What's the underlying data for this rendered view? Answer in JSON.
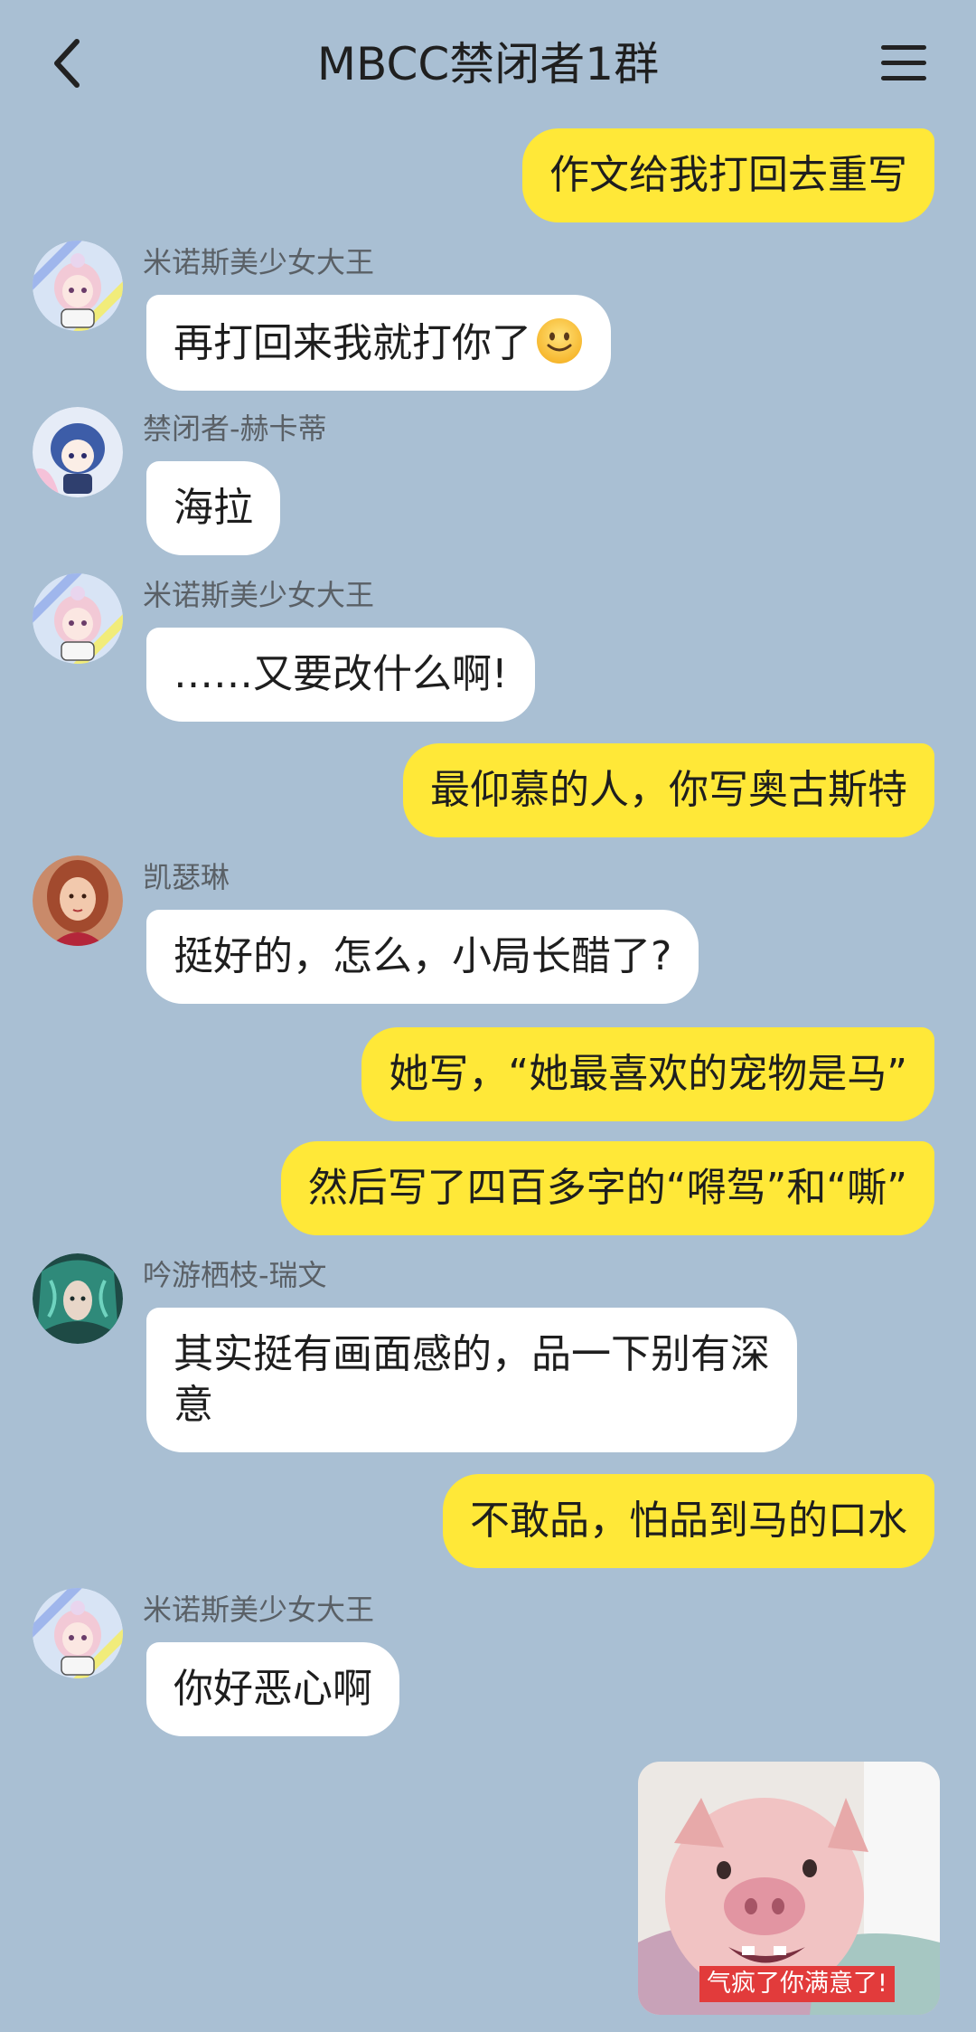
{
  "header": {
    "title": "MBCC禁闭者1群",
    "back_icon": "chevron-left-icon",
    "menu_icon": "hamburger-menu-icon"
  },
  "messages": [
    {
      "side": "out",
      "text": "作文给我打回去重写"
    },
    {
      "side": "in",
      "sender": "米诺斯美少女大王",
      "text": "再打回来我就打你了",
      "emoji": "slight-smile-emoji"
    },
    {
      "side": "in",
      "sender": "禁闭者-赫卡蒂",
      "text": "海拉"
    },
    {
      "side": "in",
      "sender": "米诺斯美少女大王",
      "text": "……又要改什么啊!"
    },
    {
      "side": "out",
      "text": "最仰慕的人，你写奥古斯特"
    },
    {
      "side": "in",
      "sender": "凯瑟琳",
      "text": "挺好的，怎么，小局长醋了?"
    },
    {
      "side": "out",
      "text": "她写，“她最喜欢的宠物是马”"
    },
    {
      "side": "out",
      "text": "然后写了四百多字的“嘚驾”和“嘶”"
    },
    {
      "side": "in",
      "sender": "吟游栖枝-瑞文",
      "text": "其实挺有画面感的，品一下别有深意"
    },
    {
      "side": "out",
      "text": "不敢品，怕品到马的口水"
    },
    {
      "side": "in",
      "sender": "米诺斯美少女大王",
      "text": "你好恶心啊"
    }
  ],
  "sticker": {
    "caption": "气疯了你满意了!",
    "subject": "piglet-sticker"
  },
  "colors": {
    "background": "#a9bfd3",
    "incoming_bubble": "#ffffff",
    "outgoing_bubble": "#ffe838",
    "sender_name": "#5a6066"
  }
}
